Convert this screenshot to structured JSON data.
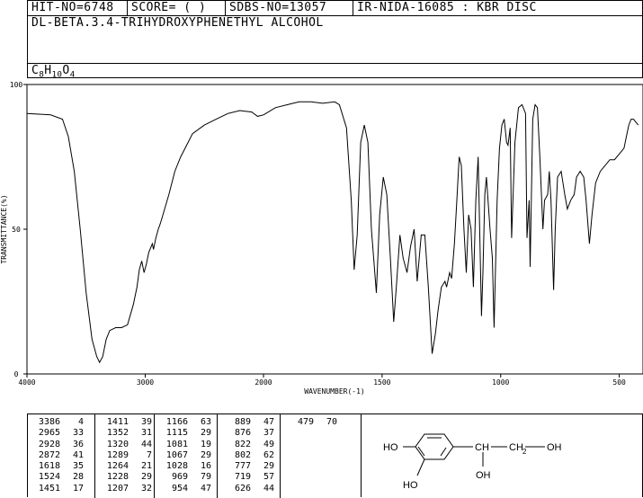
{
  "header": {
    "hit_no": "HIT-NO=6748",
    "score": "SCORE=  (   )",
    "sdbs_no": "SDBS-NO=13057",
    "method": "IR-NIDA-16085 : KBR DISC",
    "compound": "DL-BETA.3.4-TRIHYDROXYPHENETHYL ALCOHOL",
    "formula_parts": [
      "C",
      "8",
      "H",
      "10",
      "O",
      "4"
    ]
  },
  "chart_data": {
    "type": "line",
    "xlabel": "WAVENUMBER(-1)",
    "ylabel": "TRANSMITTANCE(%)",
    "xlim": [
      4000,
      400
    ],
    "ylim": [
      0,
      100
    ],
    "x_ticks": [
      4000,
      3000,
      2000,
      1500,
      1000,
      500
    ],
    "x_tick_labels": [
      "4000",
      "3000",
      "2000",
      "1500",
      "1000",
      "500"
    ],
    "y_ticks": [
      0,
      50,
      100
    ],
    "y_tick_labels": [
      "0",
      "50",
      "100"
    ],
    "grid": false,
    "series": [
      {
        "points": [
          [
            4000,
            90
          ],
          [
            3800,
            89.5
          ],
          [
            3700,
            88
          ],
          [
            3650,
            82
          ],
          [
            3600,
            70
          ],
          [
            3550,
            50
          ],
          [
            3500,
            28
          ],
          [
            3450,
            12
          ],
          [
            3410,
            6
          ],
          [
            3386,
            4
          ],
          [
            3360,
            6
          ],
          [
            3330,
            12
          ],
          [
            3300,
            15
          ],
          [
            3250,
            16
          ],
          [
            3200,
            16
          ],
          [
            3150,
            17
          ],
          [
            3100,
            24
          ],
          [
            3070,
            30
          ],
          [
            3050,
            36
          ],
          [
            3030,
            39
          ],
          [
            3010,
            35
          ],
          [
            2990,
            38
          ],
          [
            2970,
            42
          ],
          [
            2950,
            44
          ],
          [
            2940,
            45
          ],
          [
            2930,
            43
          ],
          [
            2910,
            47
          ],
          [
            2890,
            50
          ],
          [
            2872,
            52
          ],
          [
            2850,
            55
          ],
          [
            2800,
            62
          ],
          [
            2750,
            70
          ],
          [
            2700,
            75
          ],
          [
            2650,
            79
          ],
          [
            2600,
            83
          ],
          [
            2500,
            86
          ],
          [
            2400,
            88
          ],
          [
            2300,
            90
          ],
          [
            2200,
            91
          ],
          [
            2100,
            90.5
          ],
          [
            2050,
            89
          ],
          [
            2000,
            89.5
          ],
          [
            1950,
            92
          ],
          [
            1900,
            93
          ],
          [
            1850,
            94
          ],
          [
            1800,
            94
          ],
          [
            1750,
            93.5
          ],
          [
            1700,
            94
          ],
          [
            1680,
            93
          ],
          [
            1650,
            85
          ],
          [
            1630,
            60
          ],
          [
            1618,
            36
          ],
          [
            1605,
            48
          ],
          [
            1590,
            80
          ],
          [
            1575,
            86
          ],
          [
            1560,
            80
          ],
          [
            1545,
            50
          ],
          [
            1524,
            28
          ],
          [
            1510,
            55
          ],
          [
            1495,
            68
          ],
          [
            1480,
            62
          ],
          [
            1465,
            40
          ],
          [
            1451,
            18
          ],
          [
            1440,
            30
          ],
          [
            1425,
            48
          ],
          [
            1411,
            40
          ],
          [
            1395,
            35
          ],
          [
            1380,
            44
          ],
          [
            1365,
            50
          ],
          [
            1352,
            32
          ],
          [
            1335,
            48
          ],
          [
            1320,
            48
          ],
          [
            1305,
            30
          ],
          [
            1289,
            7
          ],
          [
            1275,
            14
          ],
          [
            1264,
            22
          ],
          [
            1250,
            30
          ],
          [
            1235,
            32
          ],
          [
            1228,
            30
          ],
          [
            1215,
            35
          ],
          [
            1207,
            33
          ],
          [
            1195,
            45
          ],
          [
            1185,
            60
          ],
          [
            1175,
            75
          ],
          [
            1166,
            72
          ],
          [
            1155,
            50
          ],
          [
            1145,
            35
          ],
          [
            1135,
            55
          ],
          [
            1125,
            50
          ],
          [
            1115,
            30
          ],
          [
            1105,
            60
          ],
          [
            1095,
            75
          ],
          [
            1081,
            20
          ],
          [
            1075,
            35
          ],
          [
            1067,
            62
          ],
          [
            1060,
            68
          ],
          [
            1045,
            50
          ],
          [
            1035,
            40
          ],
          [
            1028,
            16
          ],
          [
            1015,
            60
          ],
          [
            1005,
            78
          ],
          [
            995,
            86
          ],
          [
            985,
            88
          ],
          [
            975,
            80
          ],
          [
            969,
            79
          ],
          [
            960,
            85
          ],
          [
            954,
            47
          ],
          [
            940,
            80
          ],
          [
            925,
            92
          ],
          [
            910,
            93
          ],
          [
            895,
            90
          ],
          [
            889,
            47
          ],
          [
            880,
            60
          ],
          [
            876,
            37
          ],
          [
            865,
            88
          ],
          [
            855,
            93
          ],
          [
            845,
            92
          ],
          [
            835,
            75
          ],
          [
            822,
            50
          ],
          [
            815,
            60
          ],
          [
            802,
            62
          ],
          [
            795,
            70
          ],
          [
            788,
            60
          ],
          [
            777,
            29
          ],
          [
            770,
            50
          ],
          [
            760,
            68
          ],
          [
            745,
            70
          ],
          [
            730,
            62
          ],
          [
            719,
            57
          ],
          [
            705,
            60
          ],
          [
            690,
            62
          ],
          [
            680,
            68
          ],
          [
            665,
            70
          ],
          [
            650,
            68
          ],
          [
            640,
            60
          ],
          [
            626,
            45
          ],
          [
            615,
            55
          ],
          [
            600,
            66
          ],
          [
            580,
            70
          ],
          [
            560,
            72
          ],
          [
            540,
            74
          ],
          [
            520,
            74
          ],
          [
            500,
            76
          ],
          [
            480,
            78
          ],
          [
            470,
            82
          ],
          [
            460,
            86
          ],
          [
            450,
            88
          ],
          [
            440,
            88
          ],
          [
            430,
            87
          ],
          [
            420,
            86
          ]
        ]
      }
    ]
  },
  "peak_table": [
    {
      "col": [
        [
          "3386",
          "4"
        ],
        [
          "2965",
          "33"
        ],
        [
          "2928",
          "36"
        ],
        [
          "2872",
          "41"
        ],
        [
          "1618",
          "35"
        ],
        [
          "1524",
          "28"
        ],
        [
          "1451",
          "17"
        ]
      ]
    },
    {
      "col": [
        [
          "1411",
          "39"
        ],
        [
          "1352",
          "31"
        ],
        [
          "1320",
          "44"
        ],
        [
          "1289",
          "7"
        ],
        [
          "1264",
          "21"
        ],
        [
          "1228",
          "29"
        ],
        [
          "1207",
          "32"
        ]
      ]
    },
    {
      "col": [
        [
          "1166",
          "63"
        ],
        [
          "1115",
          "29"
        ],
        [
          "1081",
          "19"
        ],
        [
          "1067",
          "29"
        ],
        [
          "1028",
          "16"
        ],
        [
          "969",
          "79"
        ],
        [
          "954",
          "47"
        ]
      ]
    },
    {
      "col": [
        [
          "889",
          "47"
        ],
        [
          "876",
          "37"
        ],
        [
          "822",
          "49"
        ],
        [
          "802",
          "62"
        ],
        [
          "777",
          "29"
        ],
        [
          "719",
          "57"
        ],
        [
          "626",
          "44"
        ]
      ]
    },
    {
      "col": [
        [
          "479",
          "70"
        ]
      ]
    }
  ],
  "structure": {
    "labels": [
      "HO",
      "HO",
      "CH",
      "CH",
      "2",
      "OH",
      "OH"
    ]
  }
}
